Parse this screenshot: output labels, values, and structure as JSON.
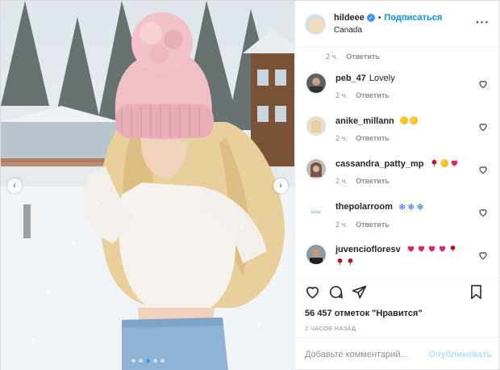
{
  "post": {
    "header": {
      "username": "hildeee",
      "separator": "•",
      "follow_label": "Подписаться",
      "location": "Canada",
      "more_label": "···"
    },
    "top_comment_meta": {
      "time": "2 ч.",
      "reply": "Ответить"
    },
    "comments": [
      {
        "user": "peb_47",
        "text": "Lovely",
        "time": "2 ч.",
        "reply": "Ответить"
      },
      {
        "user": "anike_millann",
        "text": "",
        "emojis": [
          "face-with-heart-eyes",
          "face-blowing-kiss"
        ],
        "time": "2 ч.",
        "reply": "Ответить"
      },
      {
        "user": "cassandra_patty_mp",
        "text": "",
        "emojis": [
          "rose",
          "smiling-face",
          "red-heart"
        ],
        "time": "2 ч.",
        "reply": "Ответить"
      },
      {
        "user": "thepolarroom",
        "text": "",
        "emojis": [
          "snowflake",
          "snowflake",
          "snowflake"
        ],
        "time": "2 ч.",
        "reply": "Ответить"
      },
      {
        "user": "juvenciofloresv",
        "text": "",
        "emojis": [
          "red-heart",
          "red-heart",
          "red-heart",
          "red-heart",
          "rose",
          "rose",
          "rose"
        ]
      }
    ],
    "likes_text": "56 457 отметок \"Нравится\"",
    "time_ago": "2 ЧАСОВ НАЗАД",
    "comment_input": {
      "placeholder": "Добавьте комментарий...",
      "value": ""
    },
    "publish_label": "Опубликовать",
    "icons": {
      "like": "heart-icon",
      "comment": "comment-icon",
      "share": "paper-plane-icon",
      "save": "bookmark-icon",
      "verified": "verified-badge-icon"
    },
    "colors": {
      "link_blue": "#0095f6",
      "publish_disabled": "#b2dffc",
      "muted": "#8e8e8e",
      "text": "#262626"
    }
  }
}
